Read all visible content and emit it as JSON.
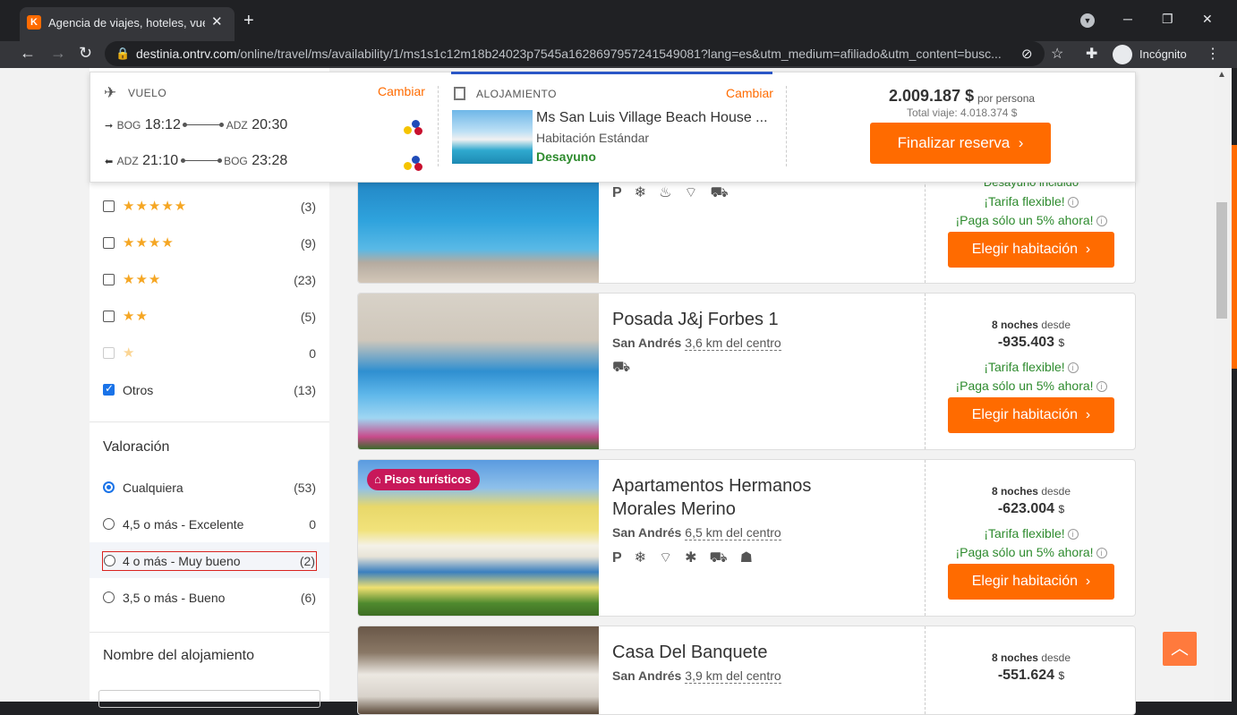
{
  "browser": {
    "tab_title": "Agencia de viajes, hoteles, vuelos",
    "tab_favicon": "K",
    "url_host": "destinia.ontrv.com",
    "url_path": "/online/travel/ms/availability/1/ms1s1c12m18b24023p7545a1628697957241549081?lang=es&utm_medium=afiliado&utm_content=busc...",
    "incognito_label": "Incógnito"
  },
  "summary": {
    "flight_label": "VUELO",
    "flight_change": "Cambiar",
    "outbound": {
      "from": "BOG",
      "dep": "18:12",
      "to": "ADZ",
      "arr": "20:30"
    },
    "inbound": {
      "from": "ADZ",
      "dep": "21:10",
      "to": "BOG",
      "arr": "23:28"
    },
    "lodging_label": "ALOJAMIENTO",
    "lodging_change": "Cambiar",
    "hotel_name": "Ms San Luis Village Beach House ...",
    "room": "Habitación Estándar",
    "board": "Desayuno",
    "price": "2.009.187 $",
    "per_person": "por persona",
    "total": "Total viaje: 4.018.374 $",
    "cta": "Finalizar reserva"
  },
  "filters": {
    "stars": [
      {
        "count": "(3)"
      },
      {
        "count": "(9)"
      },
      {
        "count": "(23)"
      },
      {
        "count": "(5)"
      },
      {
        "count": "0"
      }
    ],
    "otros": {
      "label": "Otros",
      "count": "(13)"
    },
    "rating_title": "Valoración",
    "ratings": [
      {
        "label": "Cualquiera",
        "count": "(53)"
      },
      {
        "label": "4,5 o más - Excelente",
        "count": "0"
      },
      {
        "label": "4 o más - Muy bueno",
        "count": "(2)"
      },
      {
        "label": "3,5 o más - Bueno",
        "count": "(6)"
      }
    ],
    "name_title": "Nombre del alojamiento"
  },
  "cards": [
    {
      "title": "",
      "city": "",
      "dist": "",
      "nights": "",
      "price": "",
      "breakfast": "Desayuno incluido",
      "flexible": "¡Tarifa flexible!",
      "pay": "¡Paga sólo un 5% ahora!",
      "button": "Elegir habitación"
    },
    {
      "title": "Posada J&j Forbes 1",
      "city": "San Andrés",
      "dist": "3,6 km del centro",
      "nights": "8 noches",
      "from": "desde",
      "price": "-935.403",
      "currency": "$",
      "flexible": "¡Tarifa flexible!",
      "pay": "¡Paga sólo un 5% ahora!",
      "button": "Elegir habitación"
    },
    {
      "badge": "Pisos turísticos",
      "title": "Apartamentos Hermanos Morales Merino",
      "city": "San Andrés",
      "dist": "6,5 km del centro",
      "nights": "8 noches",
      "from": "desde",
      "price": "-623.004",
      "currency": "$",
      "flexible": "¡Tarifa flexible!",
      "pay": "¡Paga sólo un 5% ahora!",
      "button": "Elegir habitación"
    },
    {
      "title": "Casa Del Banquete",
      "city": "San Andrés",
      "dist": "3,9 km del centro",
      "nights": "8 noches",
      "from": "desde",
      "price": "-551.624",
      "currency": "$"
    }
  ],
  "colors": {
    "accent": "#ff6b00",
    "green": "#2e8b2e",
    "badge": "#c8185a",
    "link_blue": "#2a56c6"
  }
}
